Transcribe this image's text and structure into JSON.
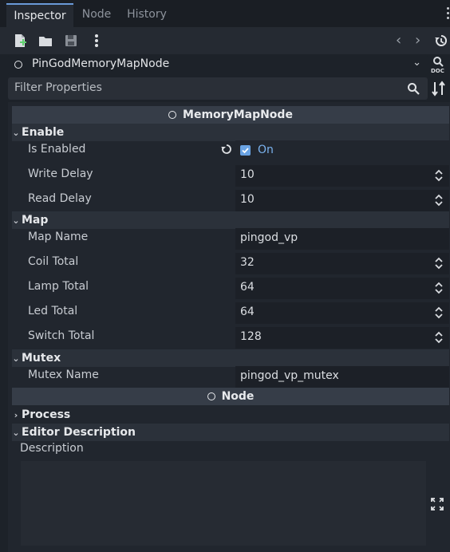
{
  "tabs": [
    {
      "label": "Inspector"
    },
    {
      "label": "Node"
    },
    {
      "label": "History"
    }
  ],
  "object_selector": {
    "value": "PinGodMemoryMapNode"
  },
  "filter": {
    "placeholder": "Filter Properties"
  },
  "categories": {
    "memory_map_node": "MemoryMapNode",
    "node": "Node"
  },
  "sections": {
    "enable": "Enable",
    "map": "Map",
    "mutex": "Mutex",
    "process": "Process",
    "editor_description": "Editor Description"
  },
  "props": {
    "is_enabled": {
      "label": "Is Enabled",
      "value": "On"
    },
    "write_delay": {
      "label": "Write Delay",
      "value": "10"
    },
    "read_delay": {
      "label": "Read Delay",
      "value": "10"
    },
    "map_name": {
      "label": "Map Name",
      "value": "pingod_vp"
    },
    "coil_total": {
      "label": "Coil Total",
      "value": "32"
    },
    "lamp_total": {
      "label": "Lamp Total",
      "value": "64"
    },
    "led_total": {
      "label": "Led Total",
      "value": "64"
    },
    "switch_total": {
      "label": "Switch Total",
      "value": "128"
    },
    "mutex_name": {
      "label": "Mutex Name",
      "value": "pingod_vp_mutex"
    },
    "description": {
      "label": "Description",
      "value": ""
    }
  },
  "colors": {
    "accent": "#6aa3e3",
    "background": "#1d2229",
    "category_bar": "#363d48"
  }
}
